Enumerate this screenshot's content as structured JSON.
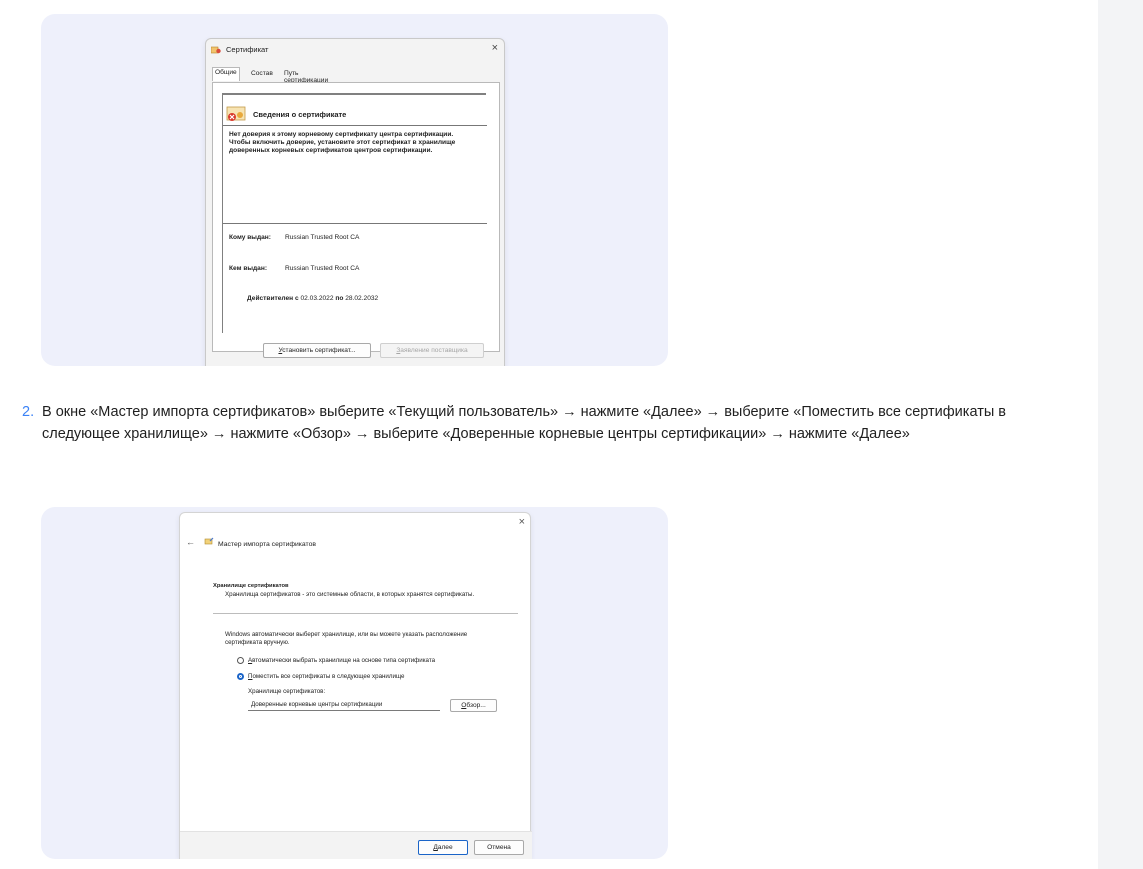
{
  "cert_dialog": {
    "title": "Сертификат",
    "close": "×",
    "tabs": [
      "Общие",
      "Состав",
      "Путь сертификации"
    ],
    "header": "Сведения о сертификате",
    "warning": "Нет доверия к этому корневому сертификату центра сертификации. Чтобы включить доверие, установите этот сертификат в хранилище доверенных корневых сертификатов центров сертификации.",
    "issued_to_label": "Кому выдан:",
    "issued_to_value": "Russian Trusted Root CA",
    "issued_by_label": "Кем выдан:",
    "issued_by_value": "Russian Trusted Root CA",
    "valid_from_label": "Действителен с",
    "valid_from": "02.03.2022",
    "valid_to_label": "по",
    "valid_to": "28.02.2032",
    "install_btn_first": "У",
    "install_btn_rest": "становить сертификат...",
    "issuer_btn_first": "З",
    "issuer_btn_rest": "аявление поставщика"
  },
  "step": {
    "number": "2.",
    "text": "В окне «Мастер импорта сертификатов» выберите «Текущий пользователь» → нажмите «Далее» → выберите «Поместить все сертификаты в следующее хранилище» → нажмите «Обзор» → выберите «Доверенные корневые центры сертификации» → нажмите «Далее»"
  },
  "wizard": {
    "close": "×",
    "back": "←",
    "title": "Мастер импорта сертификатов",
    "section_title": "Хранилище сертификатов",
    "section_desc": "Хранилища сертификатов - это системные области, в которых хранятся сертификаты.",
    "info": "Windows автоматически выберет хранилище, или вы можете указать расположение сертификата вручную.",
    "option_auto_first": "А",
    "option_auto_rest": "втоматически выбрать хранилище на основе типа сертификата",
    "option_manual_first": "П",
    "option_manual_rest": "оместить все сертификаты в следующее хранилище",
    "store_label": "Хранилище сертификатов:",
    "store_value": "Доверенные корневые центры сертификации",
    "browse_first": "О",
    "browse_rest": "бзор...",
    "next_first": "Д",
    "next_rest": "алее",
    "cancel": "Отмена"
  }
}
